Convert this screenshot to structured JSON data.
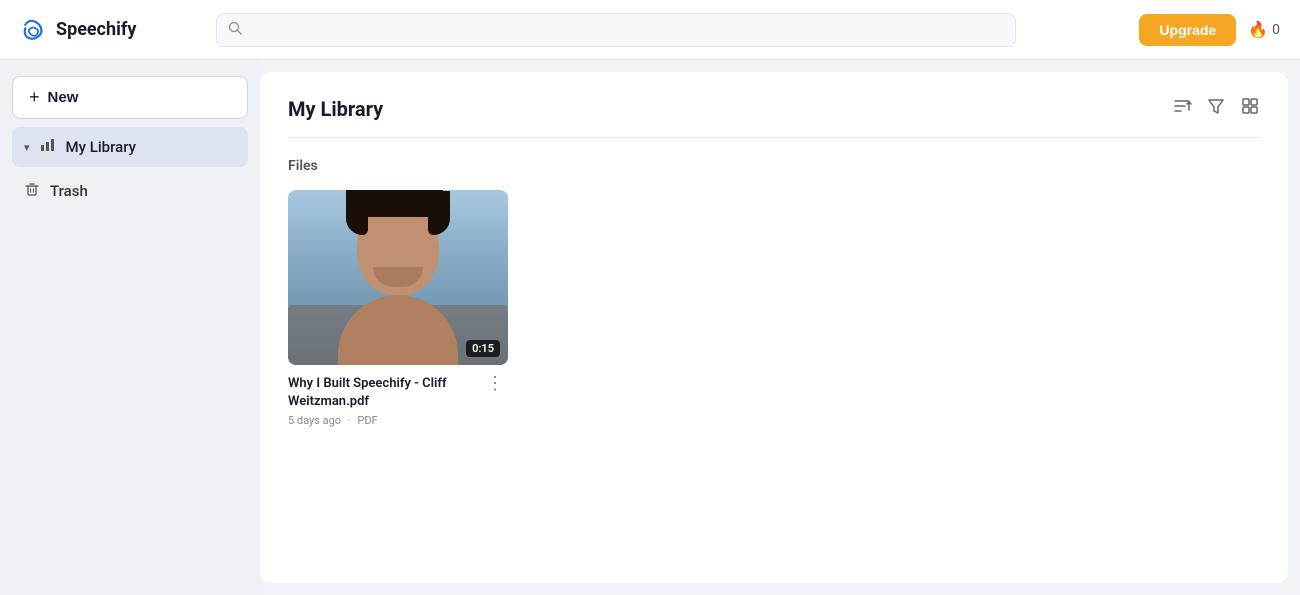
{
  "app": {
    "name": "Speechify"
  },
  "topnav": {
    "logo_label": "Speechify",
    "search_placeholder": "",
    "upgrade_label": "Upgrade",
    "flame_count": "0"
  },
  "sidebar": {
    "new_label": "+ New",
    "items": [
      {
        "id": "my-library",
        "label": "My Library",
        "active": true,
        "icon": "chart-icon",
        "chevron": true
      },
      {
        "id": "trash",
        "label": "Trash",
        "active": false,
        "icon": "trash-icon",
        "chevron": false
      }
    ]
  },
  "main": {
    "title": "My Library",
    "sections": [
      {
        "label": "Files",
        "files": [
          {
            "id": "file-1",
            "name": "Why I Built Speechify - Cliff Weitzman.pdf",
            "ago": "5 days ago",
            "type": "PDF",
            "duration": "0:15"
          }
        ]
      }
    ]
  },
  "icons": {
    "sort_icon": "≡↓",
    "filter_icon": "▽",
    "grid_icon": "⊞",
    "more_icon": "⋮",
    "search_char": "🔍"
  }
}
